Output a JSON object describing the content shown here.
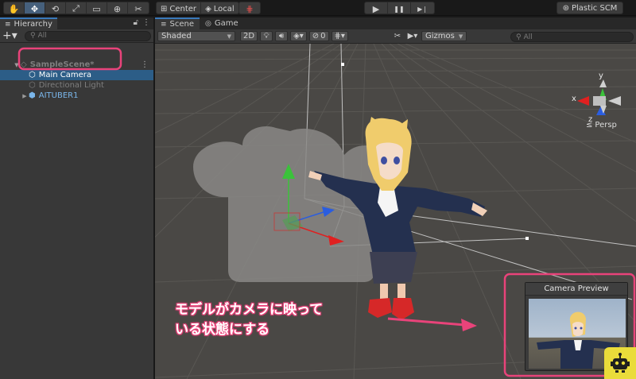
{
  "toolbar": {
    "tools": [
      {
        "icon": "hand-tool-icon",
        "glyph": "✋"
      },
      {
        "icon": "move-tool-icon",
        "glyph": "✥"
      },
      {
        "icon": "rotate-tool-icon",
        "glyph": "⟲"
      },
      {
        "icon": "scale-tool-icon",
        "glyph": "⤢"
      },
      {
        "icon": "rect-tool-icon",
        "glyph": "▭"
      },
      {
        "icon": "transform-tool-icon",
        "glyph": "⊕"
      },
      {
        "icon": "custom-tool-icon",
        "glyph": "✂"
      }
    ],
    "pivot_mode": "Center",
    "pivot_rotation": "Local",
    "grid_snap_icon": "grid-snap-icon",
    "play_buttons": [
      {
        "icon": "play-icon",
        "glyph": "▶"
      },
      {
        "icon": "pause-icon",
        "glyph": "❚❚"
      },
      {
        "icon": "step-icon",
        "glyph": "▶❘"
      }
    ],
    "plastic_scm": "Plastic SCM"
  },
  "hierarchy": {
    "tab_label": "Hierarchy",
    "search_placeholder": "All",
    "add_label": "+▾",
    "items": [
      {
        "label": "SampleScene*",
        "indent": 0,
        "state": "faded"
      },
      {
        "label": "Main Camera",
        "indent": 1,
        "state": "selected"
      },
      {
        "label": "Directional Light",
        "indent": 1,
        "state": "faded"
      },
      {
        "label": "AITUBER1",
        "indent": 1,
        "state": "prefab"
      }
    ]
  },
  "scene": {
    "tabs": [
      {
        "label": "Scene",
        "icon": "scene-tab-icon",
        "glyph": "≡",
        "active": true
      },
      {
        "label": "Game",
        "icon": "game-tab-icon",
        "glyph": "◎",
        "active": false
      }
    ],
    "shading_mode": "Shaded",
    "mode_2d": "2D",
    "hidden_count": "0",
    "gizmos_label": "Gizmos",
    "search_placeholder": "All",
    "persp_label": "Persp",
    "axis_labels": {
      "y": "y",
      "x": "x",
      "z": "z"
    },
    "camera_preview_title": "Camera Preview"
  },
  "annotation": {
    "line1": "モデルがカメラに映って",
    "line2": "いる状態にする",
    "color": "#e9437a"
  },
  "colors": {
    "highlight": "#e9437a",
    "selection": "#2c5d87",
    "axis_x": "#e02020",
    "axis_y": "#3ac23a",
    "axis_z": "#2a5de0"
  }
}
